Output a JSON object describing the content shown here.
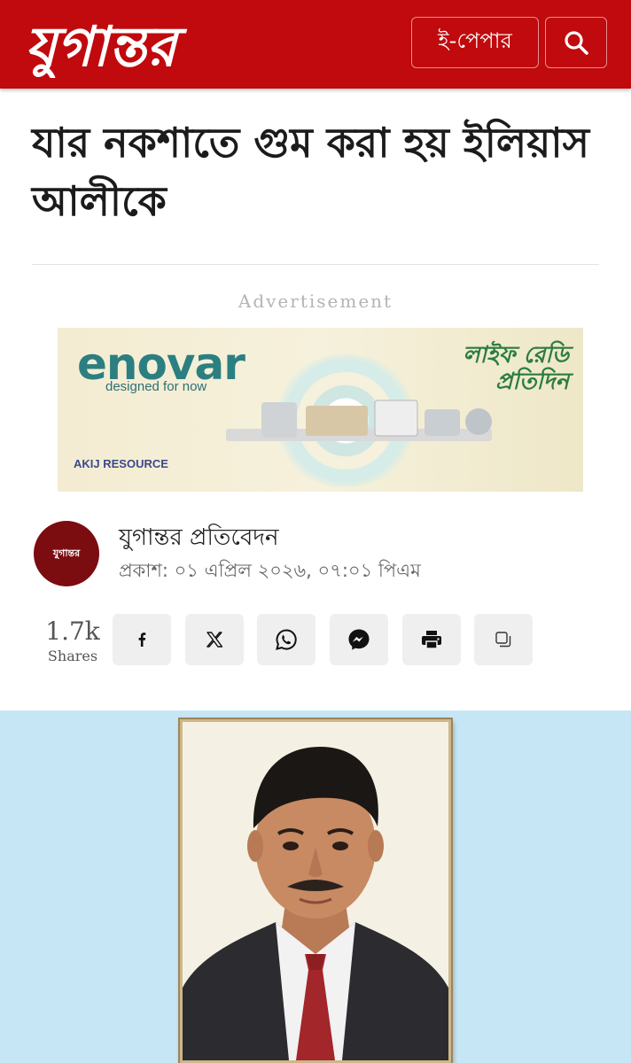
{
  "header": {
    "logo_text": "যুগান্তর",
    "epaper_label": "ই-পেপার",
    "search_icon": "search-icon"
  },
  "article": {
    "headline": "যার নকশাতে গুম করা হয় ইলিয়াস আলীকে"
  },
  "ad": {
    "label": "Advertisement",
    "brand": "enovar",
    "tagline": "designed for now",
    "slogan": "লাইফ রেডি প্রতিদিন",
    "sub_brand": "AKIJ RESOURCE"
  },
  "author": {
    "avatar_text": "যুগান্তর",
    "name": "যুগান্তর প্রতিবেদন",
    "published": "প্রকাশ: ০১ এপ্রিল ২০২৬, ০৭:০১ পিএম"
  },
  "share": {
    "count": "1.7k",
    "label": "Shares",
    "buttons": [
      "facebook-icon",
      "x-icon",
      "whatsapp-icon",
      "messenger-icon",
      "print-icon",
      "copy-icon"
    ]
  },
  "colors": {
    "header_red": "#c00a0d",
    "photo_bg": "#c7e6f5"
  }
}
